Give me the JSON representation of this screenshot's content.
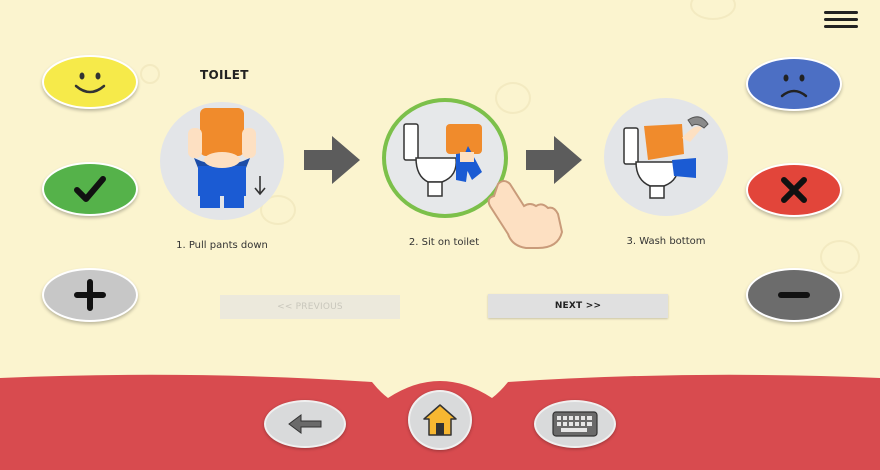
{
  "page": {
    "title": "TOILET"
  },
  "steps": [
    {
      "label": "1. Pull pants down",
      "active": false
    },
    {
      "label": "2. Sit on toilet",
      "active": true
    },
    {
      "label": "3. Wash bottom",
      "active": false
    }
  ],
  "navigation": {
    "previous_label": "<< PREVIOUS",
    "next_label": "NEXT >>",
    "previous_enabled": false
  },
  "left_buttons": [
    {
      "name": "happy-face",
      "color": "#f5e84a"
    },
    {
      "name": "check",
      "color": "#55b24a"
    },
    {
      "name": "plus",
      "color": "#bdbdbd"
    }
  ],
  "right_buttons": [
    {
      "name": "sad-face",
      "color": "#4a6fc2"
    },
    {
      "name": "cross",
      "color": "#e14538"
    },
    {
      "name": "minus",
      "color": "#6e6e6e"
    }
  ],
  "colors": {
    "background": "#fbf4cf",
    "bottom_bar": "#d84b4f",
    "active_ring": "#7cc04a"
  },
  "bottom_bar": [
    "back-arrow-icon",
    "home-icon",
    "keyboard-icon"
  ]
}
